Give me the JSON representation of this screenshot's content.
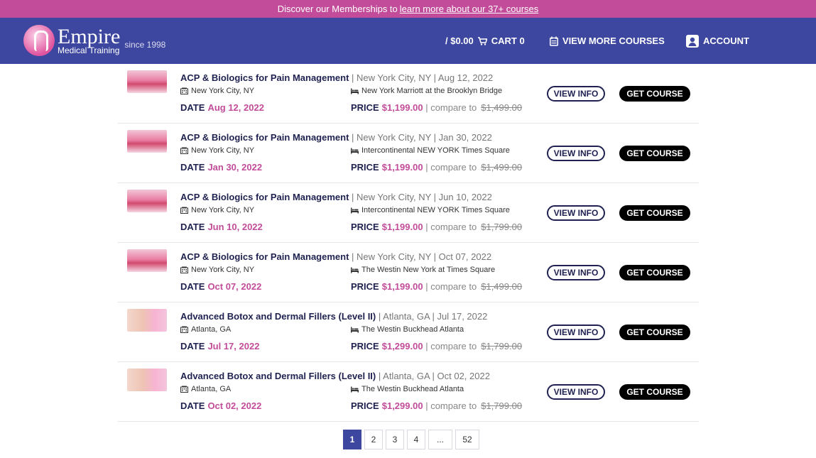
{
  "promo": {
    "text": "Discover our Memberships to",
    "link": "learn more about our 37+ courses"
  },
  "header": {
    "brand": "Empire",
    "brand_sub": "Medical Training",
    "since": "since 1998",
    "cart_total": "/ $0.00",
    "cart_label": "CART 0",
    "courses_label": "VIEW MORE COURSES",
    "account_label": "ACCOUNT"
  },
  "courses": [
    {
      "name": "ACP & Biologics for Pain Management",
      "meta": "| New York City, NY | Aug 12, 2022",
      "city": "New York City, NY",
      "venue": "New York Marriott at the Brooklyn Bridge",
      "date_label": "DATE",
      "date": "Aug 12, 2022",
      "price_label": "PRICE",
      "price": "$1,199.00",
      "compare": "| compare to",
      "old_price": "$1,499.00",
      "thumb": "prp"
    },
    {
      "name": "ACP & Biologics for Pain Management",
      "meta": "| New York City, NY | Jan 30, 2022",
      "city": "New York City, NY",
      "venue": "Intercontinental NEW YORK Times Square",
      "date_label": "DATE",
      "date": "Jan 30, 2022",
      "price_label": "PRICE",
      "price": "$1,199.00",
      "compare": "| compare to",
      "old_price": "$1,499.00",
      "thumb": "prp"
    },
    {
      "name": "ACP & Biologics for Pain Management",
      "meta": "| New York City, NY | Jun 10, 2022",
      "city": "New York City, NY",
      "venue": "Intercontinental NEW YORK Times Square",
      "date_label": "DATE",
      "date": "Jun 10, 2022",
      "price_label": "PRICE",
      "price": "$1,199.00",
      "compare": "| compare to",
      "old_price": "$1,799.00",
      "thumb": "prp"
    },
    {
      "name": "ACP & Biologics for Pain Management",
      "meta": "| New York City, NY | Oct 07, 2022",
      "city": "New York City, NY",
      "venue": "The Westin New York at Times Square",
      "date_label": "DATE",
      "date": "Oct 07, 2022",
      "price_label": "PRICE",
      "price": "$1,199.00",
      "compare": "| compare to",
      "old_price": "$1,499.00",
      "thumb": "prp"
    },
    {
      "name": "Advanced Botox and Dermal Fillers (Level II)",
      "meta": "| Atlanta, GA | Jul 17, 2022",
      "city": "Atlanta, GA",
      "venue": "The Westin Buckhead Atlanta",
      "date_label": "DATE",
      "date": "Jul 17, 2022",
      "price_label": "PRICE",
      "price": "$1,299.00",
      "compare": "| compare to",
      "old_price": "$1,799.00",
      "thumb": "botox"
    },
    {
      "name": "Advanced Botox and Dermal Fillers (Level II)",
      "meta": "| Atlanta, GA | Oct 02, 2022",
      "city": "Atlanta, GA",
      "venue": "The Westin Buckhead Atlanta",
      "date_label": "DATE",
      "date": "Oct 02, 2022",
      "price_label": "PRICE",
      "price": "$1,299.00",
      "compare": "| compare to",
      "old_price": "$1,799.00",
      "thumb": "botox"
    }
  ],
  "buttons": {
    "info": "VIEW INFO",
    "get": "GET COURSE"
  },
  "pagination": {
    "pages": [
      "1",
      "2",
      "3",
      "4",
      "...",
      "52"
    ],
    "current": "1"
  },
  "colors": {
    "brand": "#3d47a0",
    "accent": "#c24c9a"
  }
}
